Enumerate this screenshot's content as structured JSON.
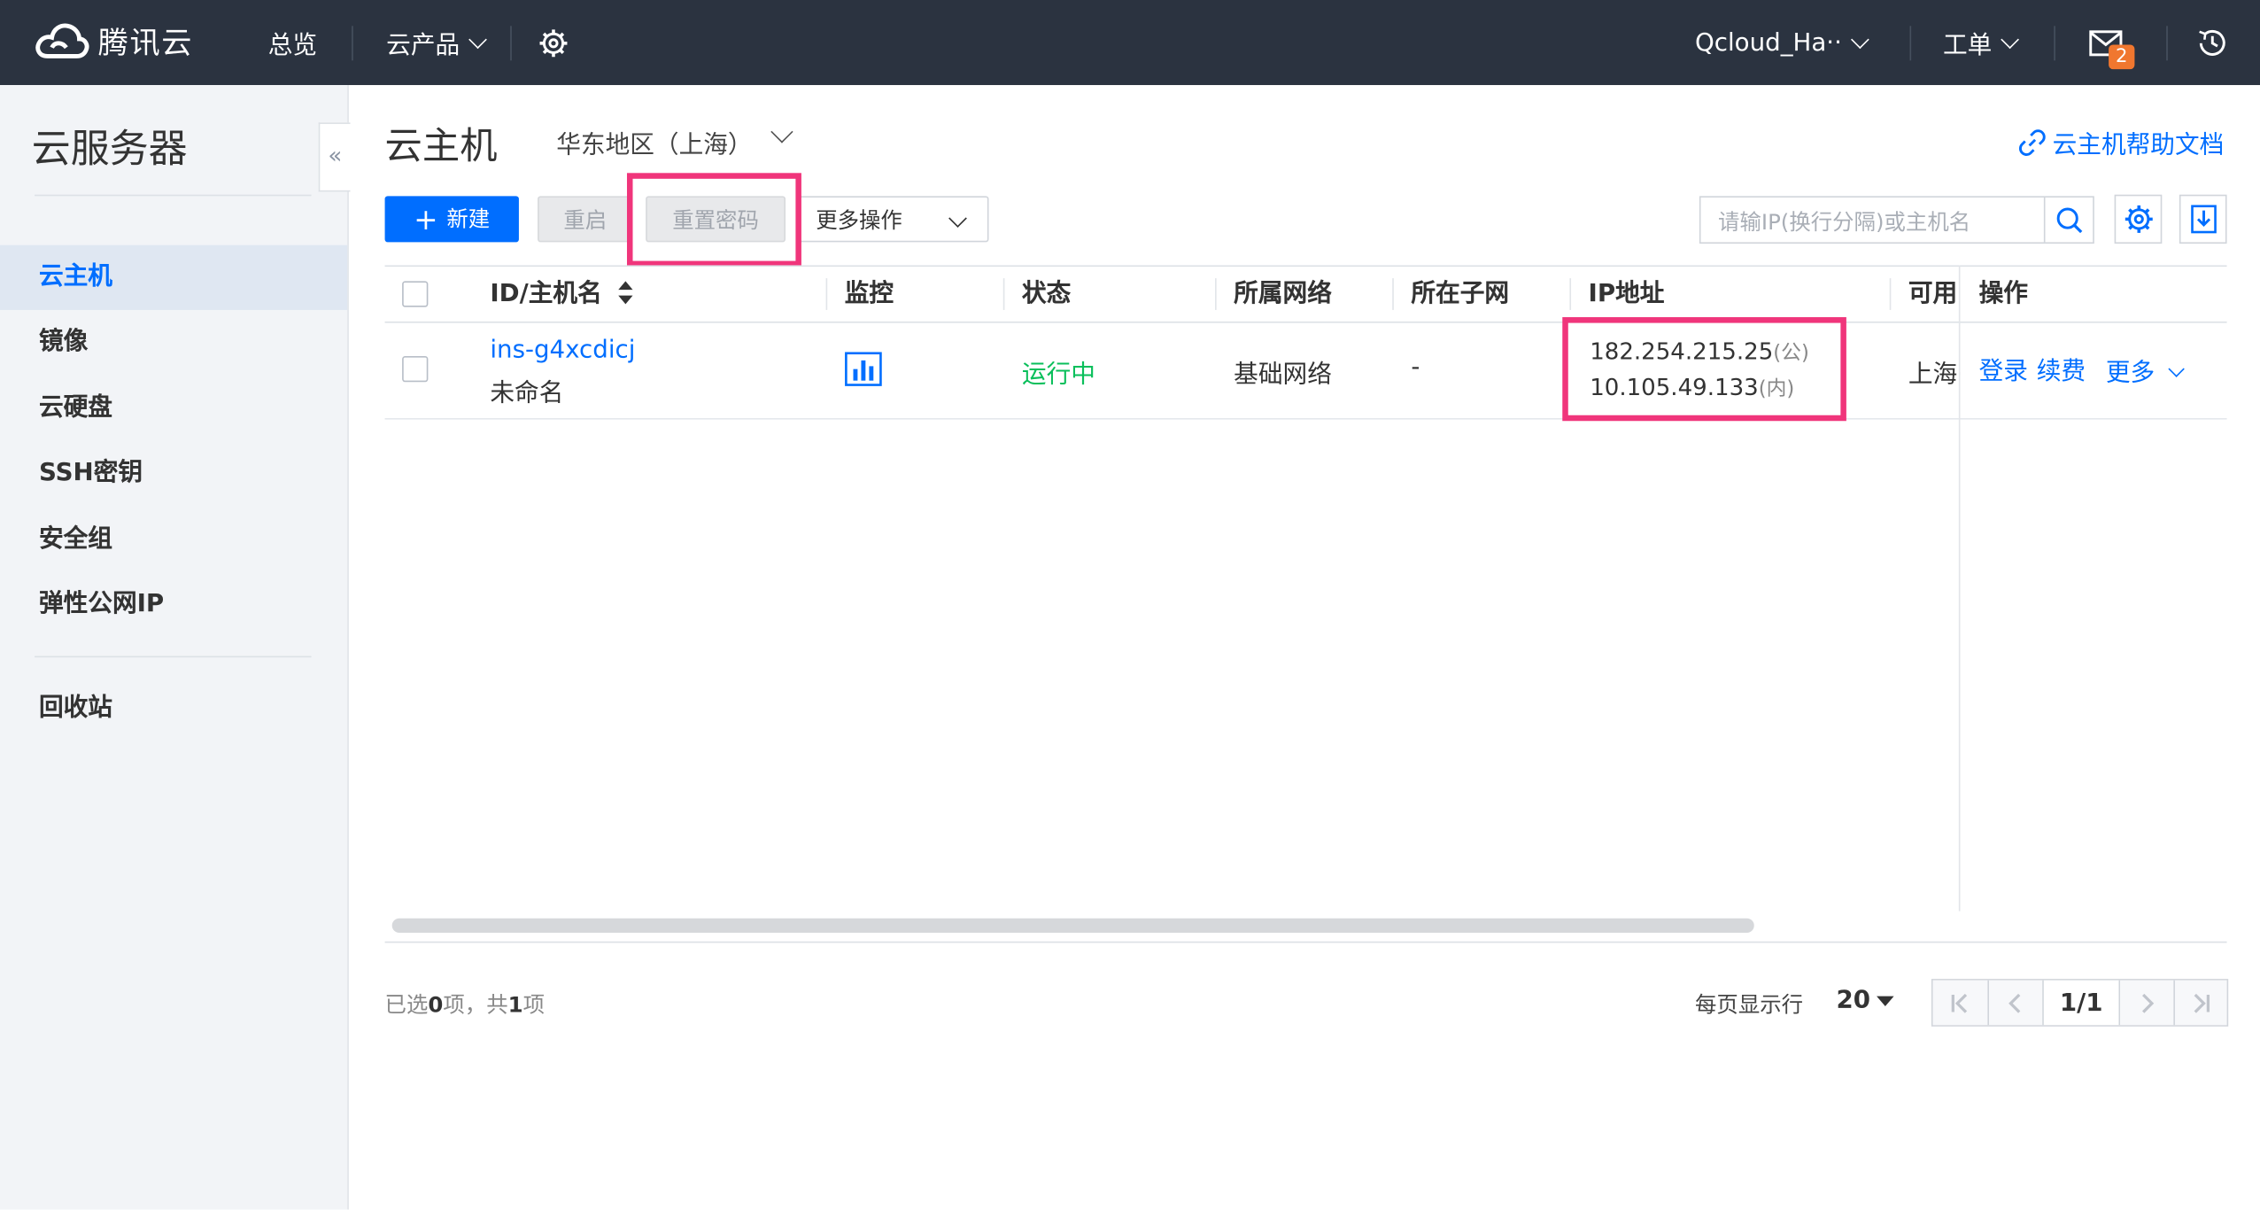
{
  "topbar": {
    "logo_text": "腾讯云",
    "overview": "总览",
    "products": "云产品",
    "account": "Qcloud_Ha··",
    "ticket": "工单",
    "mail_count": "2"
  },
  "sidebar": {
    "title": "云服务器",
    "items": [
      {
        "label": "云主机",
        "active": true
      },
      {
        "label": "镜像"
      },
      {
        "label": "云硬盘"
      },
      {
        "label": "SSH密钥"
      },
      {
        "label": "安全组"
      },
      {
        "label": "弹性公网IP"
      }
    ],
    "recycle": "回收站",
    "collapse_glyph": "«"
  },
  "main": {
    "title": "云主机",
    "region": "华东地区（上海）",
    "help_link": "云主机帮助文档",
    "toolbar": {
      "new_label": "新建",
      "restart_label": "重启",
      "reset_password_label": "重置密码",
      "more_label": "更多操作"
    },
    "search_placeholder": "请输IP(换行分隔)或主机名",
    "columns": {
      "id": "ID/主机名",
      "monitor": "监控",
      "status": "状态",
      "network": "所属网络",
      "subnet": "所在子网",
      "ip": "IP地址",
      "zone": "可用",
      "ops": "操作"
    },
    "rows": [
      {
        "id": "ins-g4xcdicj",
        "name": "未命名",
        "status": "运行中",
        "network": "基础网络",
        "subnet": "-",
        "ip_public": "182.254.215.25",
        "ip_public_tag": "(公)",
        "ip_private": "10.105.49.133",
        "ip_private_tag": "(内)",
        "zone": "上海·",
        "op_login": "登录",
        "op_renew": "续费",
        "op_more": "更多"
      }
    ],
    "footer": {
      "selected_prefix": "已选",
      "selected_count": "0",
      "selected_mid": "项，共",
      "total_count": "1",
      "selected_suffix": "项",
      "per_page_label": "每页显示行",
      "per_page_value": "20",
      "page_indicator": "1/1"
    }
  },
  "colors": {
    "topbar_bg": "#2b3340",
    "primary": "#006eff",
    "running": "#0abf5b",
    "highlight": "#f0357b",
    "badge": "#f0772f"
  }
}
